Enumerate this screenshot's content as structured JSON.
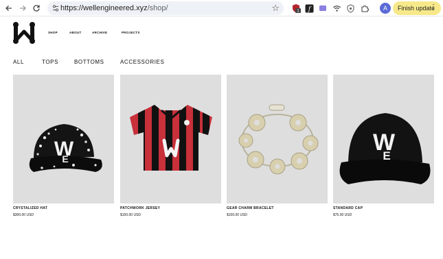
{
  "browser": {
    "url_host": "wellengineered.xyz",
    "url_path": "/shop/",
    "extension_badge": "1",
    "profile_initial": "A",
    "update_label": "Finish update",
    "back_icon": "arrow-left-icon",
    "forward_icon": "arrow-right-icon",
    "reload_icon": "reload-icon",
    "bookmark_icon": "star-icon"
  },
  "site": {
    "nav": [
      "SHOP",
      "ABOUT",
      "ARCHIVE",
      "PROJECTS"
    ],
    "filters": [
      "ALL",
      "TOPS",
      "BOTTOMS",
      "ACCESSORIES"
    ]
  },
  "products": [
    {
      "name": "CRYSTALIZED HAT",
      "price": "$300.00 USD"
    },
    {
      "name": "PATCHWORK JERSEY",
      "price": "$150.00 USD"
    },
    {
      "name": "GEAR CHARM BRACELET",
      "price": "$100.00 USD"
    },
    {
      "name": "STANDARD CAP",
      "price": "$75.00 USD"
    }
  ],
  "colors": {
    "card_bg": "#dedede",
    "update_bg": "#f7e98a",
    "jersey_red": "#c8303a",
    "jersey_black": "#111111"
  }
}
